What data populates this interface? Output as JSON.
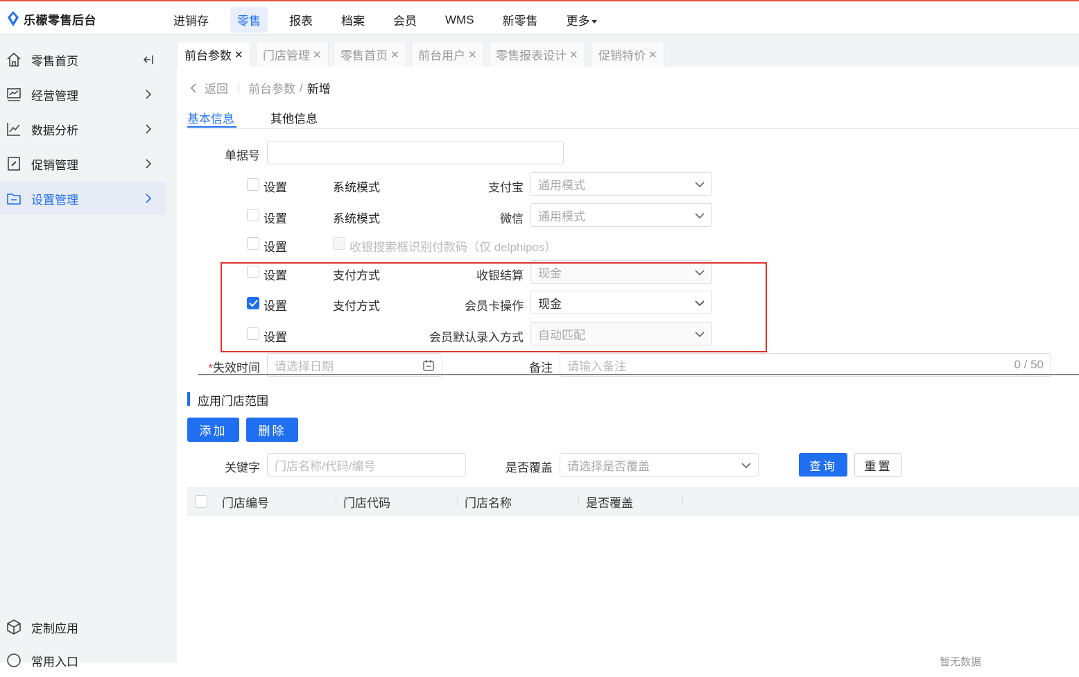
{
  "app": {
    "title": "乐檬零售后台"
  },
  "topnav": [
    {
      "label": "进销存",
      "active": false
    },
    {
      "label": "零售",
      "active": true
    },
    {
      "label": "报表",
      "active": false
    },
    {
      "label": "档案",
      "active": false
    },
    {
      "label": "会员",
      "active": false
    },
    {
      "label": "WMS",
      "active": false
    },
    {
      "label": "新零售",
      "active": false
    },
    {
      "label": "更多",
      "active": false
    }
  ],
  "sidebar": {
    "items": [
      {
        "label": "零售首页"
      },
      {
        "label": "经营管理"
      },
      {
        "label": "数据分析"
      },
      {
        "label": "促销管理"
      },
      {
        "label": "设置管理"
      }
    ],
    "bottom": [
      {
        "label": "定制应用"
      },
      {
        "label": "常用入口"
      }
    ]
  },
  "tabs": [
    {
      "label": "前台参数"
    },
    {
      "label": "门店管理"
    },
    {
      "label": "零售首页"
    },
    {
      "label": "前台用户"
    },
    {
      "label": "零售报表设计"
    },
    {
      "label": "促销特价"
    }
  ],
  "breadcrumb": {
    "back": "返回",
    "parent": "前台参数",
    "sep": "/",
    "current": "新增"
  },
  "subtabs": [
    {
      "label": "基本信息"
    },
    {
      "label": "其他信息"
    }
  ],
  "form": {
    "doc_no_label": "单据号",
    "doc_no_value": "",
    "set_label": "设置",
    "rows": [
      {
        "checked": false,
        "category": "系统模式",
        "field": "支付宝",
        "value": "通用模式"
      },
      {
        "checked": false,
        "category": "系统模式",
        "field": "微信",
        "value": "通用模式"
      },
      {
        "checked": false,
        "option": "收银搜索框识别付款码（仅 delphipos）"
      },
      {
        "checked": false,
        "category": "支付方式",
        "field": "收银结算",
        "value": "现金"
      },
      {
        "checked": true,
        "category": "支付方式",
        "field": "会员卡操作",
        "value": "现金"
      },
      {
        "checked": false,
        "category": "",
        "field": "会员默认录入方式",
        "value": "自动匹配"
      }
    ],
    "expire_label": "失效时间",
    "expire_required": "*",
    "expire_placeholder": "请选择日期",
    "remark_label": "备注",
    "remark_placeholder": "请输入备注",
    "remark_count": "0 / 50"
  },
  "store_scope": {
    "title": "应用门店范围",
    "add_label": "添加",
    "delete_label": "删除",
    "keyword_label": "关键字",
    "keyword_placeholder": "门店名称/代码/编号",
    "cover_label": "是否覆盖",
    "cover_placeholder": "请选择是否覆盖",
    "query_label": "查询",
    "reset_label": "重置",
    "columns": [
      "门店编号",
      "门店代码",
      "门店名称",
      "是否覆盖"
    ],
    "empty_text": "暂无数据"
  },
  "colors": {
    "accent": "#1f6ff0",
    "highlight_box": "#e03131",
    "topbar_line": "#e8503a"
  }
}
